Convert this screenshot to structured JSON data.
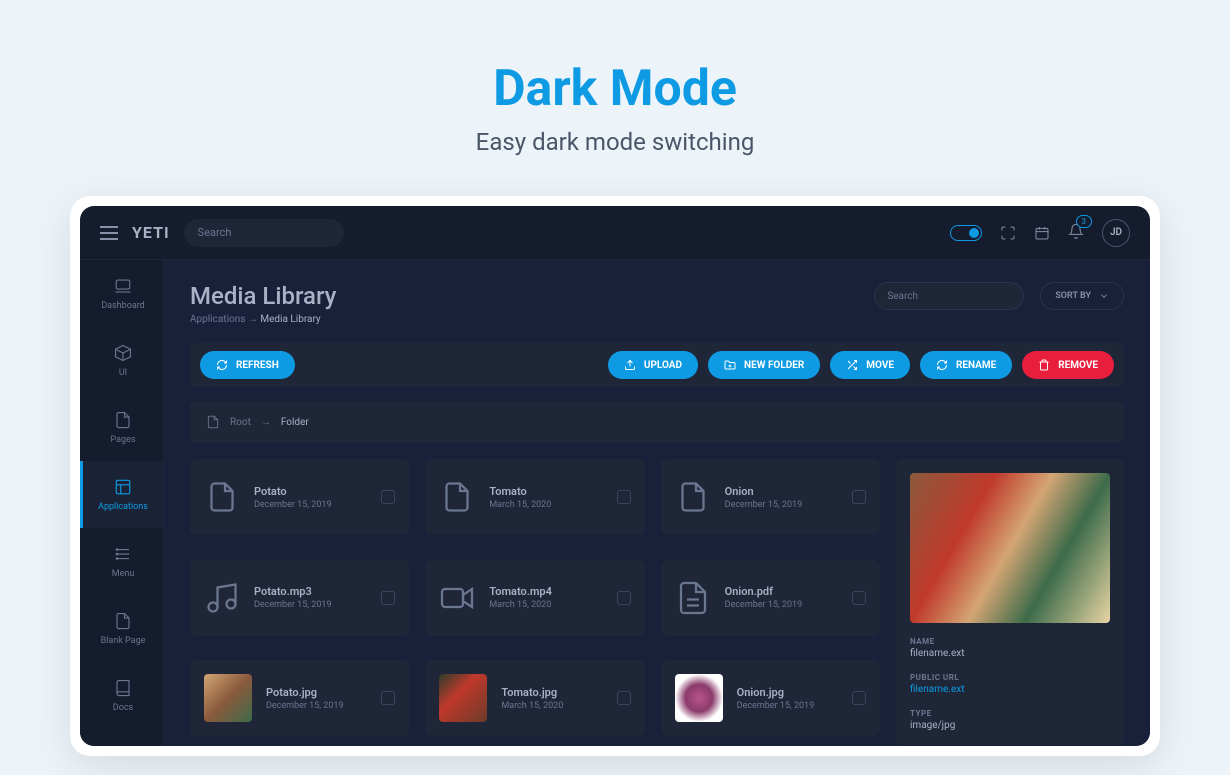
{
  "hero": {
    "title": "Dark Mode",
    "subtitle": "Easy dark mode switching"
  },
  "brand": "YETI",
  "search": {
    "placeholder": "Search"
  },
  "notifications": {
    "count": "3"
  },
  "avatar": "JD",
  "sidebar": [
    {
      "label": "Dashboard",
      "icon": "laptop"
    },
    {
      "label": "UI",
      "icon": "cube"
    },
    {
      "label": "Pages",
      "icon": "file"
    },
    {
      "label": "Applications",
      "icon": "app",
      "active": true
    },
    {
      "label": "Menu",
      "icon": "menu"
    },
    {
      "label": "Blank Page",
      "icon": "file"
    },
    {
      "label": "Docs",
      "icon": "book"
    }
  ],
  "page": {
    "title": "Media Library"
  },
  "breadcrumb": {
    "root": "Applications",
    "current": "Media Library"
  },
  "filter": {
    "placeholder": "Search"
  },
  "sort": {
    "label": "SORT BY"
  },
  "toolbar": {
    "refresh": "REFRESH",
    "upload": "UPLOAD",
    "new_folder": "NEW FOLDER",
    "move": "MOVE",
    "rename": "RENAME",
    "remove": "REMOVE"
  },
  "path": {
    "root": "Root",
    "current": "Folder"
  },
  "files": [
    {
      "name": "Potato",
      "date": "December 15, 2019",
      "type": "folder"
    },
    {
      "name": "Tomato",
      "date": "March 15, 2020",
      "type": "folder"
    },
    {
      "name": "Onion",
      "date": "December 15, 2019",
      "type": "folder"
    },
    {
      "name": "Potato.mp3",
      "date": "December 15, 2019",
      "type": "audio"
    },
    {
      "name": "Tomato.mp4",
      "date": "March 15, 2020",
      "type": "video"
    },
    {
      "name": "Onion.pdf",
      "date": "December 15, 2019",
      "type": "doc"
    },
    {
      "name": "Potato.jpg",
      "date": "December 15, 2019",
      "type": "image",
      "thumb": "thumb1"
    },
    {
      "name": "Tomato.jpg",
      "date": "March 15, 2020",
      "type": "image",
      "thumb": "thumb2"
    },
    {
      "name": "Onion.jpg",
      "date": "December 15, 2019",
      "type": "image",
      "thumb": "thumb3"
    }
  ],
  "details": {
    "name_label": "NAME",
    "name": "filename.ext",
    "url_label": "PUBLIC URL",
    "url": "filename.ext",
    "type_label": "TYPE",
    "type": "image/jpg"
  }
}
